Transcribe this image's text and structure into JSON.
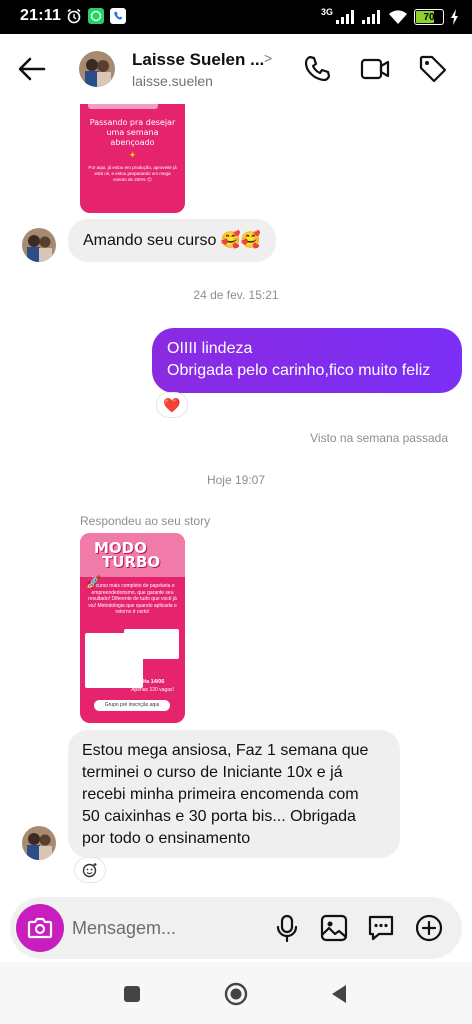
{
  "status_bar": {
    "time": "21:11",
    "network_label": "3G",
    "battery_level": "70",
    "battery_percent": 70
  },
  "header": {
    "name": "Laisse Suelen ...",
    "chevron": ">",
    "username": "laisse.suelen"
  },
  "messages": {
    "story1": {
      "line1": "Passando pra desejar uma semana abençoado",
      "line2": "Por aqui, já estou em produção, aproveite já está ok, e estou preparando um mega evento de 200% 😊"
    },
    "m1_text": "Amando seu curso 🥰🥰",
    "date1": "24 de fev. 15:21",
    "out_line1": "OIIII lindeza",
    "out_line2": "Obrigada pelo carinho,fico muito feliz",
    "out_reaction": "❤️",
    "seen": "Visto na semana passada",
    "date2": "Hoje 19:07",
    "story_reply_label": "Respondeu ao seu story",
    "story2": {
      "title1": "MODO",
      "title2": "TURBO",
      "body": "O curso mais completo de papelaria e empreendedorismo, que garante seu resultado! Diferente de tudo que você já viu! Metodologia que quando aplicada o retorno é certo!",
      "date": "Dia 14/06",
      "vagas": "Apenas 120 vagas!",
      "cta": "Grupo pré inscrição aqui"
    },
    "m2_lines": [
      "Estou mega ansiosa, Faz 1 semana que",
      "terminei o curso de Iniciante 10x e já",
      "recebi minha primeira encomenda com",
      "50 caixinhas e 30 porta bis... Obrigada",
      "por todo o ensinamento"
    ]
  },
  "composer": {
    "placeholder": "Mensagem..."
  },
  "icons": {
    "back": "arrow-left-icon",
    "call": "phone-icon",
    "video": "video-camera-icon",
    "tag": "tag-icon",
    "camera": "camera-icon",
    "mic": "microphone-icon",
    "gallery": "image-icon",
    "sticker": "sticker-chat-icon",
    "plus": "plus-circle-icon"
  },
  "colors": {
    "outgoing_bubble": "#7b2ff7",
    "camera_button": "#c81ec0",
    "story_pink": "#e6246e"
  }
}
